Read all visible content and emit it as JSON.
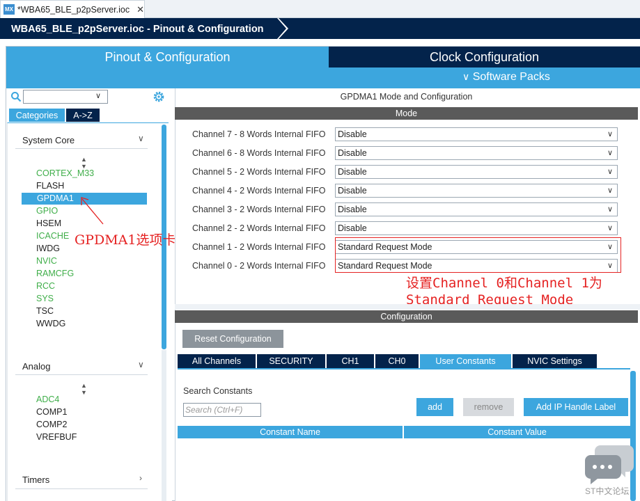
{
  "file_tab": {
    "logo": "MX",
    "title": "*WBA65_BLE_p2pServer.ioc",
    "close": "✕"
  },
  "breadcrumb": {
    "text": "WBA65_BLE_p2pServer.ioc - Pinout & Configuration"
  },
  "main_tabs": {
    "pinout": "Pinout & Configuration",
    "clock": "Clock Configuration",
    "software_packs": "Software Packs",
    "software_packs_chevron": "chevron-down-icon"
  },
  "left": {
    "tabs": {
      "categories": "Categories",
      "az": "A->Z"
    },
    "sections": [
      {
        "label": "System Core",
        "chevron": "chevron-down-icon"
      },
      {
        "label": "Analog",
        "chevron": "chevron-down-icon"
      },
      {
        "label": "Timers",
        "chevron": "chevron-right-icon"
      }
    ],
    "system_core_items": [
      {
        "label": "CORTEX_M33",
        "style": "green"
      },
      {
        "label": "FLASH",
        "style": "dark"
      },
      {
        "label": "GPDMA1",
        "style": "selected"
      },
      {
        "label": "GPIO",
        "style": "green"
      },
      {
        "label": "HSEM",
        "style": "dark"
      },
      {
        "label": "ICACHE",
        "style": "green"
      },
      {
        "label": "IWDG",
        "style": "dark"
      },
      {
        "label": "NVIC",
        "style": "green"
      },
      {
        "label": "RAMCFG",
        "style": "green"
      },
      {
        "label": "RCC",
        "style": "green"
      },
      {
        "label": "SYS",
        "style": "green"
      },
      {
        "label": "TSC",
        "style": "dark"
      },
      {
        "label": "WWDG",
        "style": "dark"
      }
    ],
    "analog_items": [
      {
        "label": "ADC4",
        "style": "green"
      },
      {
        "label": "COMP1",
        "style": "dark"
      },
      {
        "label": "COMP2",
        "style": "dark"
      },
      {
        "label": "VREFBUF",
        "style": "dark"
      }
    ]
  },
  "right": {
    "mode_title": "GPDMA1 Mode and Configuration",
    "mode_header": "Mode",
    "channels": [
      {
        "label": "Channel 7  - 8 Words Internal FIFO",
        "value": "Disable"
      },
      {
        "label": "Channel 6  - 8 Words Internal FIFO",
        "value": "Disable"
      },
      {
        "label": "Channel 5  - 2 Words Internal FIFO",
        "value": "Disable"
      },
      {
        "label": "Channel 4  - 2 Words Internal FIFO",
        "value": "Disable"
      },
      {
        "label": "Channel 3  - 2 Words Internal FIFO",
        "value": "Disable"
      },
      {
        "label": "Channel 2  - 2 Words Internal FIFO",
        "value": "Disable"
      },
      {
        "label": "Channel 1  - 2 Words Internal FIFO",
        "value": "Standard Request Mode"
      },
      {
        "label": "Channel 0  - 2 Words Internal FIFO",
        "value": "Standard Request Mode"
      }
    ],
    "config_header": "Configuration",
    "reset_button": "Reset Configuration",
    "config_tabs": [
      "All Channels",
      "SECURITY",
      "CH1",
      "CH0",
      "User Constants",
      "NVIC Settings"
    ],
    "active_tab": "User Constants",
    "search_label": "Search Constants",
    "search_placeholder": "Search (Ctrl+F)",
    "add_button": "add",
    "remove_button": "remove",
    "add_ip_button": "Add IP Handle Label",
    "columns": [
      "Constant Name",
      "Constant Value"
    ]
  },
  "annotations": {
    "left_note": "GPDMA1选项卡",
    "right_note_line1": "设置Channel 0和Channel 1为",
    "right_note_line2": "Standard Request Mode",
    "color": "#e52222"
  },
  "watermark": {
    "label": "ST中文论坛"
  },
  "colors": {
    "accent": "#3ca6de",
    "navy": "#03234b",
    "green": "#3fae49",
    "header_gray": "#5a5a5a"
  }
}
